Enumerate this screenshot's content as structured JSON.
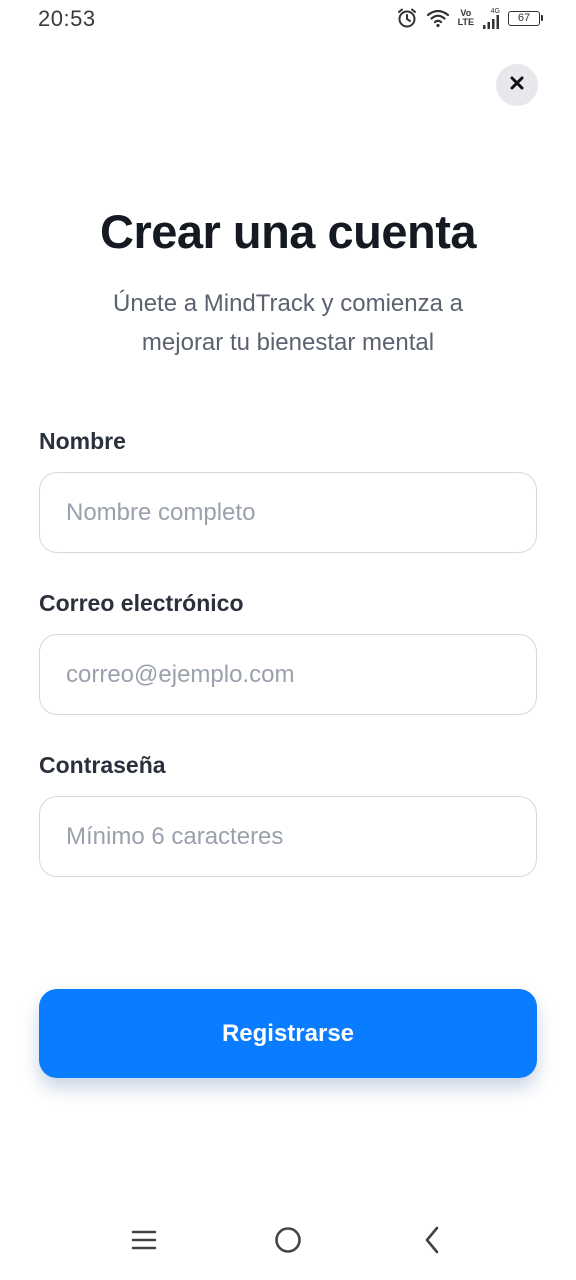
{
  "status_bar": {
    "time": "20:53",
    "network_top": "Vo",
    "network_bottom": "LTE",
    "network_gen": "4G",
    "battery": "67"
  },
  "header": {
    "close_icon": "close-icon"
  },
  "main": {
    "title": "Crear una cuenta",
    "subtitle": "Únete a MindTrack y comienza a mejorar tu bienestar mental"
  },
  "form": {
    "name": {
      "label": "Nombre",
      "placeholder": "Nombre completo",
      "value": ""
    },
    "email": {
      "label": "Correo electrónico",
      "placeholder": "correo@ejemplo.com",
      "value": ""
    },
    "password": {
      "label": "Contraseña",
      "placeholder": "Mínimo 6 caracteres",
      "value": ""
    },
    "submit_label": "Registrarse"
  },
  "colors": {
    "accent": "#0a7cff",
    "title": "#151a22",
    "subtitle": "#5b6270",
    "input_border": "#d5d8de",
    "placeholder": "#9aa1ad"
  },
  "nav_bar": {
    "icons": [
      "menu-icon",
      "home-icon",
      "back-icon"
    ]
  }
}
